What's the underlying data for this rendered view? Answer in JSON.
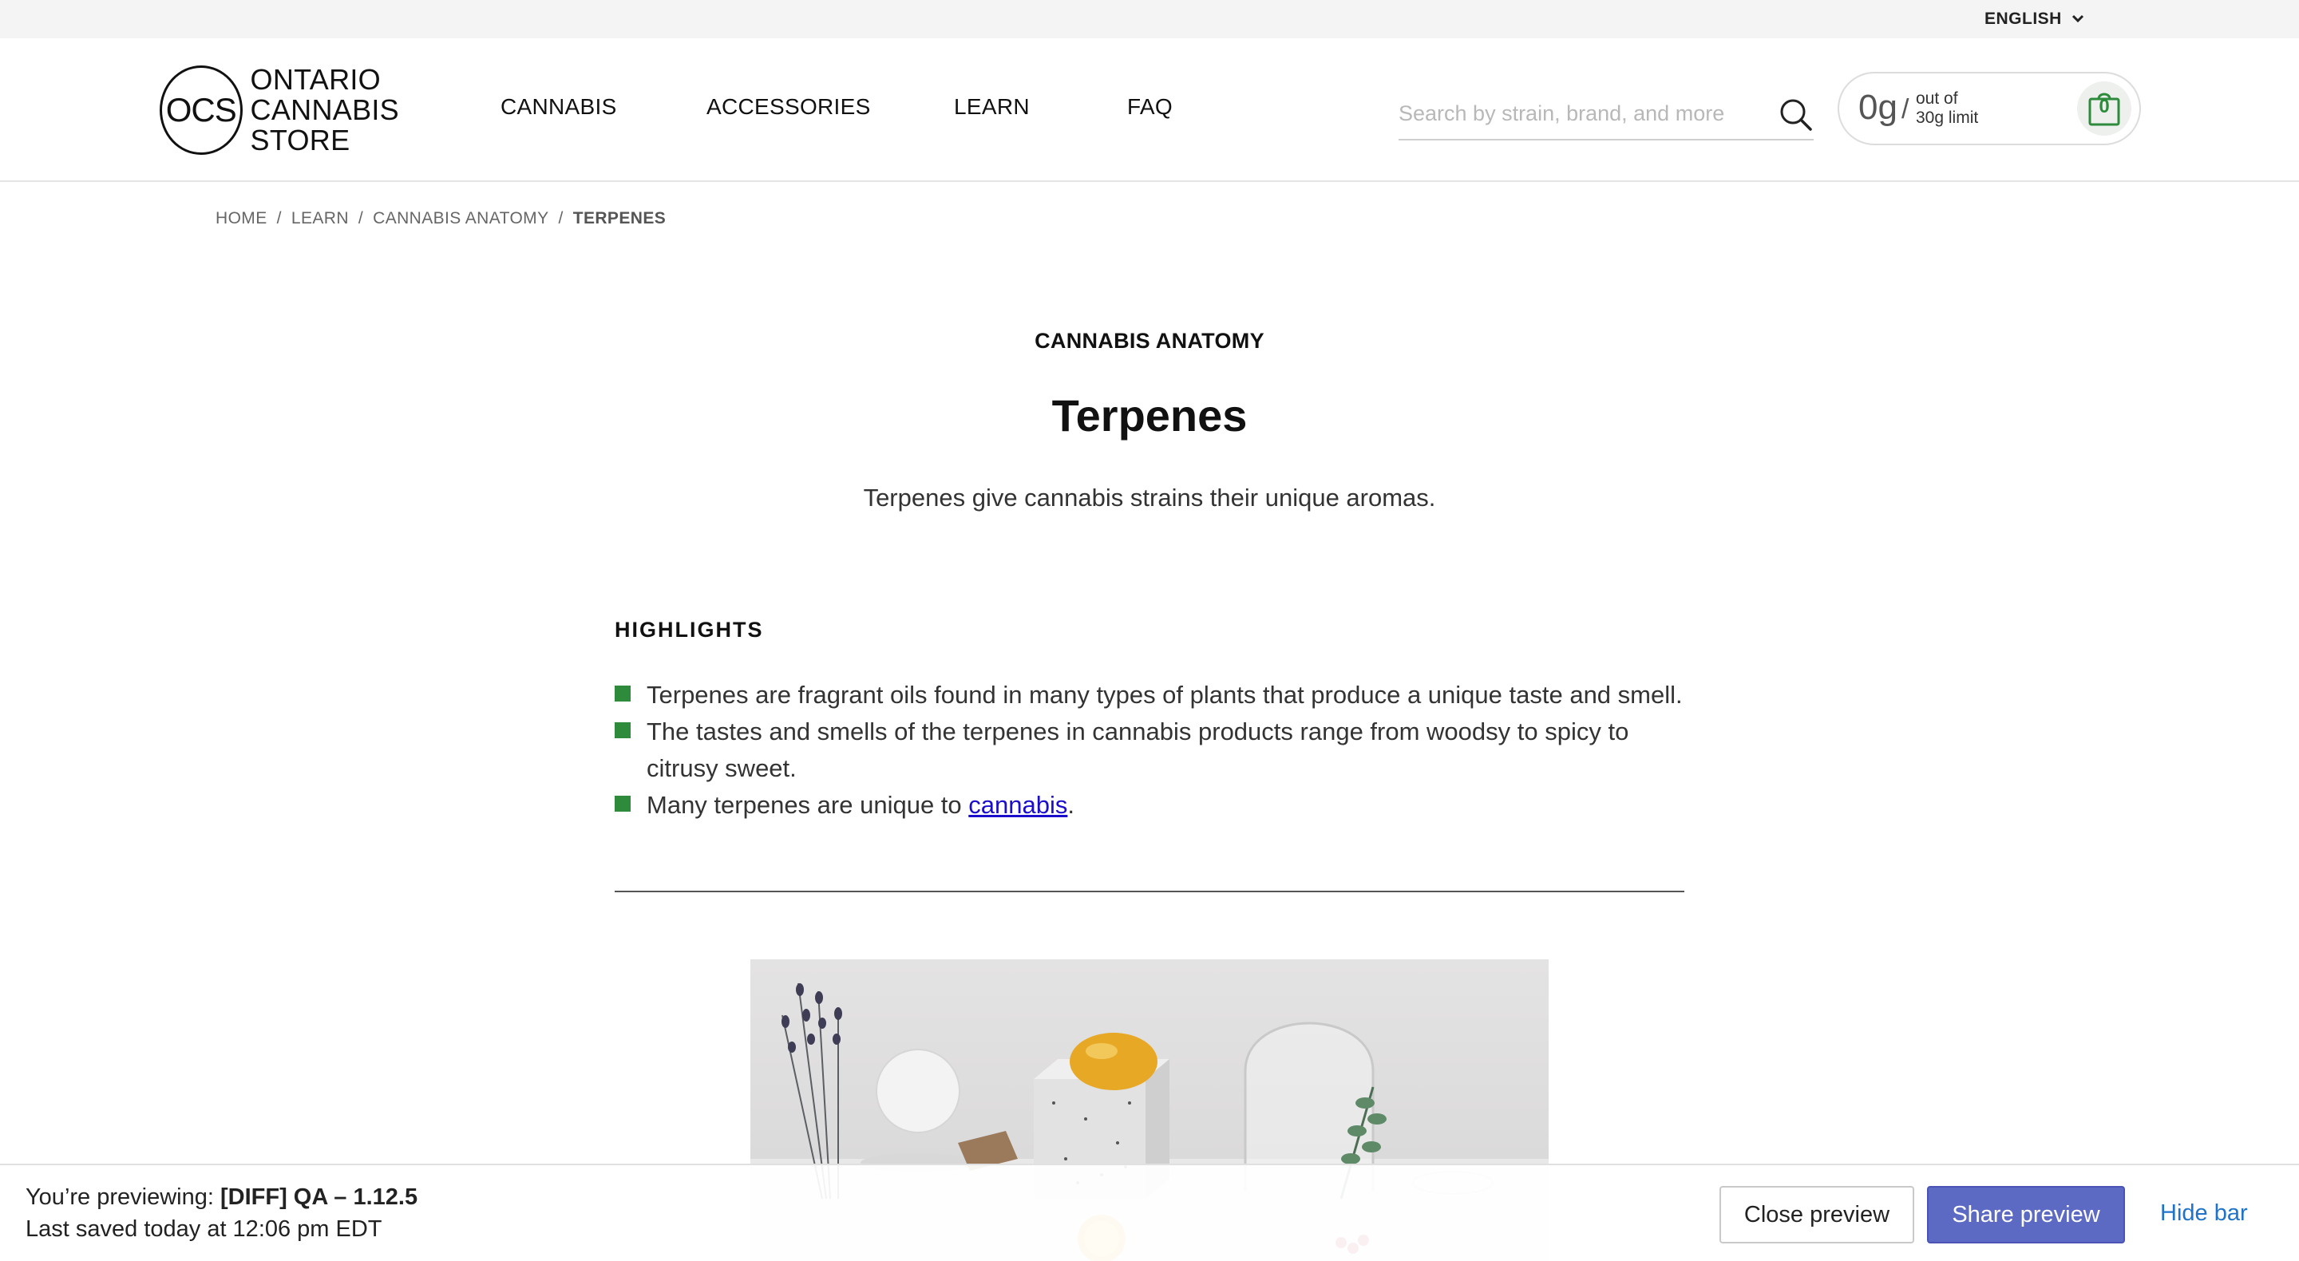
{
  "utility_bar": {
    "language": "ENGLISH"
  },
  "header": {
    "logo": {
      "mark": "OCS",
      "words": [
        "ONTARIO",
        "CANNABIS",
        "STORE"
      ]
    },
    "nav": [
      "CANNABIS",
      "ACCESSORIES",
      "LEARN",
      "FAQ"
    ],
    "search": {
      "placeholder": "Search by strain, brand, and more",
      "value": ""
    },
    "limit": {
      "amount": "0g",
      "slash": "/",
      "line1": "out of",
      "line2": "30g limit"
    },
    "cart": {
      "count": "0"
    }
  },
  "breadcrumb": {
    "items": [
      "HOME",
      "LEARN",
      "CANNABIS ANATOMY"
    ],
    "current": "TERPENES",
    "separator": "/"
  },
  "article": {
    "eyebrow": "CANNABIS ANATOMY",
    "title": "Terpenes",
    "subtitle": "Terpenes give cannabis strains their unique aromas.",
    "highlights_heading": "HIGHLIGHTS",
    "highlights": [
      "Terpenes are fragrant oils found in many types of plants that produce a unique taste and smell.",
      "The tastes and smells of the terpenes in cannabis products range from woodsy to spicy to citrusy sweet."
    ],
    "highlight_link_item": {
      "before": "Many terpenes are unique to ",
      "link": "cannabis",
      "after": "."
    }
  },
  "preview_bar": {
    "label": "You’re previewing:",
    "theme": "[DIFF] QA – 1.12.5",
    "saved": "Last saved today at 12:06 pm EDT",
    "close_label": "Close preview",
    "share_label": "Share preview",
    "hide_label": "Hide bar"
  },
  "colors": {
    "accent_green": "#2e8b3c",
    "share_button": "#5c6ac4",
    "link_blue": "#1a0dcc",
    "hide_link": "#1f73c9"
  },
  "icons": [
    "chevron-down-icon",
    "search-icon",
    "shopping-bag-icon"
  ]
}
